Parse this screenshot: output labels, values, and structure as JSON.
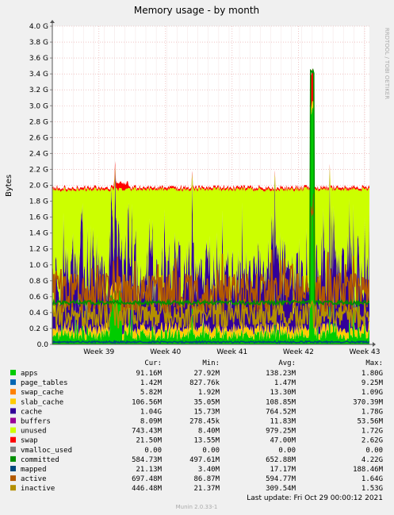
{
  "chart_data": {
    "type": "area",
    "title": "Memory usage - by month",
    "ylabel": "Bytes",
    "ylim": [
      0,
      4.0
    ],
    "yticks": [
      "0.0",
      "0.2 G",
      "0.4 G",
      "0.6 G",
      "0.8 G",
      "1.0 G",
      "1.2 G",
      "1.4 G",
      "1.6 G",
      "1.8 G",
      "2.0 G",
      "2.2 G",
      "2.4 G",
      "2.6 G",
      "2.8 G",
      "3.0 G",
      "3.2 G",
      "3.4 G",
      "3.6 G",
      "3.8 G",
      "4.0 G"
    ],
    "xticks": [
      "Week 39",
      "Week 40",
      "Week 41",
      "Week 42",
      "Week 43"
    ],
    "grid": true,
    "side_label": "RRDTOOL / TOBI OETIKER",
    "columns": [
      "",
      "Cur:",
      "Min:",
      "Avg:",
      "Max:"
    ],
    "series": [
      {
        "name": "apps",
        "color": "#00cc00",
        "cur": "91.16M",
        "min": "27.92M",
        "avg": "138.23M",
        "max": "1.80G"
      },
      {
        "name": "page_tables",
        "color": "#0066b3",
        "cur": "1.42M",
        "min": "827.76k",
        "avg": "1.47M",
        "max": "9.25M"
      },
      {
        "name": "swap_cache",
        "color": "#ff8000",
        "cur": "5.82M",
        "min": "1.92M",
        "avg": "13.30M",
        "max": "1.09G"
      },
      {
        "name": "slab_cache",
        "color": "#ffcc00",
        "cur": "106.56M",
        "min": "35.05M",
        "avg": "108.85M",
        "max": "370.39M"
      },
      {
        "name": "cache",
        "color": "#330099",
        "cur": "1.04G",
        "min": "15.73M",
        "avg": "764.52M",
        "max": "1.78G"
      },
      {
        "name": "buffers",
        "color": "#990099",
        "cur": "8.09M",
        "min": "278.45k",
        "avg": "11.83M",
        "max": "53.56M"
      },
      {
        "name": "unused",
        "color": "#ccff00",
        "cur": "743.43M",
        "min": "8.40M",
        "avg": "979.25M",
        "max": "1.72G"
      },
      {
        "name": "swap",
        "color": "#ff0000",
        "cur": "21.50M",
        "min": "13.55M",
        "avg": "47.00M",
        "max": "2.62G"
      },
      {
        "name": "vmalloc_used",
        "color": "#808080",
        "cur": "0.00",
        "min": "0.00",
        "avg": "0.00",
        "max": "0.00"
      },
      {
        "name": "committed",
        "color": "#008f00",
        "cur": "584.73M",
        "min": "497.61M",
        "avg": "652.88M",
        "max": "4.22G"
      },
      {
        "name": "mapped",
        "color": "#00487d",
        "cur": "21.13M",
        "min": "3.40M",
        "avg": "17.17M",
        "max": "188.46M"
      },
      {
        "name": "active",
        "color": "#b35a00",
        "cur": "697.48M",
        "min": "86.87M",
        "avg": "594.77M",
        "max": "1.64G"
      },
      {
        "name": "inactive",
        "color": "#b38f00",
        "cur": "446.48M",
        "min": "21.37M",
        "avg": "309.54M",
        "max": "1.53G"
      }
    ],
    "last_update": "Last update:  Fri Oct 29 00:00:12 2021",
    "footer": "Munin 2.0.33-1"
  }
}
